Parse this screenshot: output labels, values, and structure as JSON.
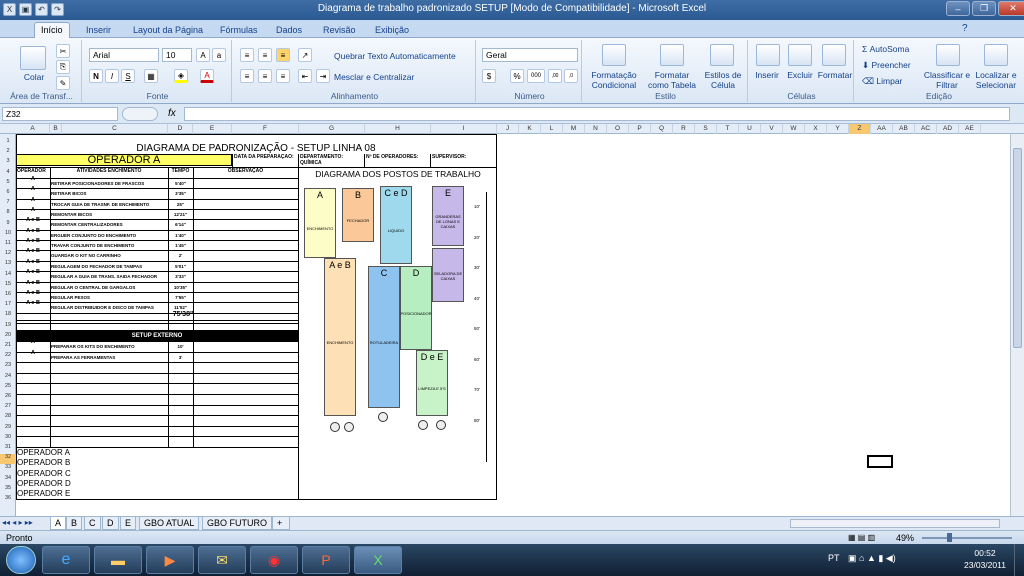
{
  "window": {
    "title": "Diagrama de trabalho padronizado SETUP  [Modo de Compatibilidade] - Microsoft Excel"
  },
  "ribbon": {
    "tabs": [
      "Início",
      "Inserir",
      "Layout da Página",
      "Fórmulas",
      "Dados",
      "Revisão",
      "Exibição"
    ],
    "clipboard": {
      "paste": "Colar",
      "label": "Área de Transf..."
    },
    "font": {
      "name": "Arial",
      "size": "10",
      "label": "Fonte",
      "bold": "N",
      "italic": "I",
      "underline": "S"
    },
    "alignment": {
      "wrap": "Quebrar Texto Automaticamente",
      "merge": "Mesclar e Centralizar",
      "label": "Alinhamento"
    },
    "number": {
      "format": "Geral",
      "label": "Número",
      "currency": "$",
      "percent": "%",
      "thousands": "000",
      "inc_dec": ",00",
      "dec_dec": ",0"
    },
    "styles": {
      "cond": "Formatação Condicional",
      "table": "Formatar como Tabela",
      "cell": "Estilos de Célula",
      "label": "Estilo"
    },
    "cells": {
      "insert": "Inserir",
      "delete": "Excluir",
      "format": "Formatar",
      "label": "Células"
    },
    "editing": {
      "autosum": "AutoSoma",
      "fill": "Preencher",
      "clear": "Limpar",
      "sort": "Classificar e Filtrar",
      "find": "Localizar e Selecionar",
      "label": "Edição"
    }
  },
  "formula_bar": {
    "name_box": "Z32",
    "fx": "fx",
    "value": ""
  },
  "columns": [
    "A",
    "B",
    "C",
    "D",
    "E",
    "F",
    "G",
    "H",
    "I",
    "J",
    "K",
    "L",
    "M",
    "N",
    "O",
    "P",
    "Q",
    "R",
    "S",
    "T",
    "U",
    "V",
    "W",
    "X",
    "Y",
    "Z",
    "AA",
    "AB",
    "AC",
    "AD",
    "AE"
  ],
  "rows": [
    "1",
    "2",
    "3",
    "4",
    "5",
    "6",
    "7",
    "8",
    "9",
    "10",
    "11",
    "12",
    "13",
    "14",
    "15",
    "16",
    "17",
    "18",
    "19",
    "20",
    "21",
    "22",
    "23",
    "24",
    "25",
    "26",
    "27",
    "28",
    "29",
    "30",
    "31",
    "32",
    "33",
    "34",
    "35",
    "36"
  ],
  "sheet": {
    "title": "DIAGRAMA DE PADRONIZAÇÃO - SETUP LINHA 08",
    "operator_title": "OPERADOR A",
    "header_fields": [
      "DATA DA PREPARAÇÃO:",
      "DEPARTAMENTO: QUÍMICA",
      "Nº DE OPERADORES:",
      "SUPERVISOR:"
    ],
    "col_headers": {
      "op": "OPERADOR",
      "act": "ATIVIDADES ENCHIMENTO",
      "time": "TEMPO",
      "obs": "OBSERVAÇÃO"
    },
    "tasks": [
      {
        "op": "A",
        "act": "RETIRAR POSICIONADORES DE FRASCOS",
        "time": "5'40\""
      },
      {
        "op": "A",
        "act": "RETIRAR BICOS",
        "time": "3'35\""
      },
      {
        "op": "A",
        "act": "TROCAR GUIA DE TRASNF. DE ENCHIMENTO",
        "time": "25\""
      },
      {
        "op": "A",
        "act": "REMONTAR BICOS",
        "time": "12'21\""
      },
      {
        "op": "A e B",
        "act": "REMONTAR CENTRALIZADORES",
        "time": "6'14\""
      },
      {
        "op": "A e B",
        "act": "ERGUER CONJUNTO DO ENCHIMENTO",
        "time": "1'40\""
      },
      {
        "op": "A e B",
        "act": "TRAVAR CONJUNTO DE ENCHIMENTO",
        "time": "1'45\""
      },
      {
        "op": "A e B",
        "act": "GUARDAR O KIT NO CARRINHO",
        "time": "2'"
      },
      {
        "op": "A e B",
        "act": "REGULAGEM DO FECHADOR DE TAMPAS",
        "time": "5'01\""
      },
      {
        "op": "A e B",
        "act": "REGULAR A GUIA DE TRANS. SAIDA FECHADOR",
        "time": "3'33\""
      },
      {
        "op": "A e B",
        "act": "REGULAR O CENTRAL DE GARGALOS",
        "time": "10'35\""
      },
      {
        "op": "A e B",
        "act": "REGULAR PESOS",
        "time": "7'55\""
      },
      {
        "op": "A e B",
        "act": "REGULAR DISTRIBUIDOR E DISCO DE TAMPAS",
        "time": "11'52\""
      }
    ],
    "total": "75'38\"",
    "ext_title": "SETUP EXTERNO",
    "ext_tasks": [
      {
        "op": "A",
        "act": "PREPARAR OS KITS DO ENCHIMENTO",
        "time": "10'"
      },
      {
        "op": "A",
        "act": "PREPARA AS FERRAMENTAS",
        "time": "3'"
      }
    ],
    "legend": [
      "OPERADOR A",
      "OPERADOR B",
      "OPERADOR C",
      "OPERADOR D",
      "OPERADOR E"
    ],
    "diagram_title": "DIAGRAMA DOS POSTOS DE TRABALHO",
    "stations": [
      {
        "head": "A",
        "body": "ENCHIMENTO",
        "color": "#fdfdc8"
      },
      {
        "head": "B",
        "body": "FECHADOR",
        "color": "#fbc89a"
      },
      {
        "head": "C e D",
        "body": "LIQUIDO",
        "color": "#9ed9ee"
      },
      {
        "head": "E",
        "body": "GRANDERAS DE LONAS E CAIXAS",
        "color": "#c7b8ea"
      },
      {
        "head": "A e B",
        "body": "ENCHIMENTO",
        "color": "#fde0b5"
      },
      {
        "head": "C",
        "body": "ROTULADEIRA",
        "color": "#8ec3f0"
      },
      {
        "head": "D",
        "body": "POSICIONADOR",
        "color": "#b6eec1"
      },
      {
        "head": "",
        "body": "SELADORA DE CAIXAS",
        "color": "#c7b8ea"
      },
      {
        "head": "D e E",
        "body": "LIMPEZA E 5'S",
        "color": "#c8f2c8"
      }
    ],
    "scale": [
      "10'",
      "20'",
      "30'",
      "40'",
      "50'",
      "60'",
      "70'",
      "80'"
    ]
  },
  "sheet_tabs": [
    "A",
    "B",
    "C",
    "D",
    "E",
    "GBO ATUAL",
    "GBO FUTURO"
  ],
  "status": {
    "ready": "Pronto",
    "zoom": "49%"
  },
  "taskbar": {
    "lang": "PT",
    "time": "00:52",
    "date": "23/03/2011"
  }
}
